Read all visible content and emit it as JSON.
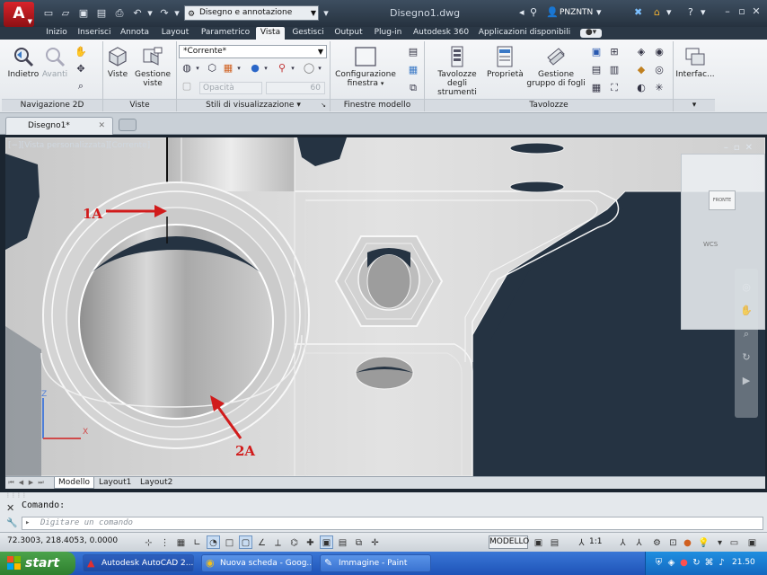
{
  "titlebar": {
    "app_logo": "A",
    "workspace": "Disegno e annotazione",
    "document_title": "Disegno1.dwg",
    "user": "PNZNTN"
  },
  "ribbon": {
    "tabs": [
      {
        "label": "Inizio"
      },
      {
        "label": "Inserisci"
      },
      {
        "label": "Annota"
      },
      {
        "label": "Layout"
      },
      {
        "label": "Parametrico"
      },
      {
        "label": "Vista"
      },
      {
        "label": "Gestisci"
      },
      {
        "label": "Output"
      },
      {
        "label": "Plug-in"
      },
      {
        "label": "Autodesk 360"
      },
      {
        "label": "Applicazioni disponibili"
      }
    ],
    "active_tab": "Vista",
    "panels": {
      "nav2d": {
        "title": "Navigazione 2D",
        "back": "Indietro",
        "forward": "Avanti"
      },
      "views": {
        "title": "Viste",
        "views_btn": "Viste",
        "manager": "Gestione viste"
      },
      "visual_styles": {
        "title": "Stili di visualizzazione",
        "current_style": "*Corrente*",
        "opacity_label": "Opacità",
        "opacity_value": "60"
      },
      "model_windows": {
        "title": "Finestre modello",
        "config": "Configurazione finestra"
      },
      "palettes": {
        "title": "Tavolozze",
        "tool_palettes": "Tavolozze degli strumenti",
        "properties": "Proprietà",
        "sheet_set": "Gestione gruppo di fogli"
      },
      "interface": {
        "title": "",
        "label": "Interfac..."
      }
    }
  },
  "document_tabs": [
    {
      "label": "Disegno1*"
    }
  ],
  "viewport": {
    "label": "[−][Vista personalizzata][Corrente]",
    "viewcube_face": "FRONTE",
    "wcs": "WCS",
    "ucs_x": "X",
    "ucs_y": "Z",
    "callouts": {
      "a": "1A",
      "b": "2A"
    }
  },
  "layout_tabs": [
    {
      "label": "Modello"
    },
    {
      "label": "Layout1"
    },
    {
      "label": "Layout2"
    }
  ],
  "command": {
    "history": "Comando:",
    "placeholder": "Digitare un comando"
  },
  "statusbar": {
    "coords": "72.3003, 218.4053, 0.0000",
    "space": "MODELLO",
    "scale": "1:1"
  },
  "taskbar": {
    "start": "start",
    "apps": [
      {
        "label": "Autodesk AutoCAD 2..."
      },
      {
        "label": "Nuova scheda - Goog..."
      },
      {
        "label": "Immagine - Paint"
      }
    ],
    "clock": "21.50"
  },
  "colors": {
    "viewport_bg": "#253342",
    "callout": "#d11b1b",
    "taskbar": "#245edb",
    "start": "#3c8f3c"
  }
}
